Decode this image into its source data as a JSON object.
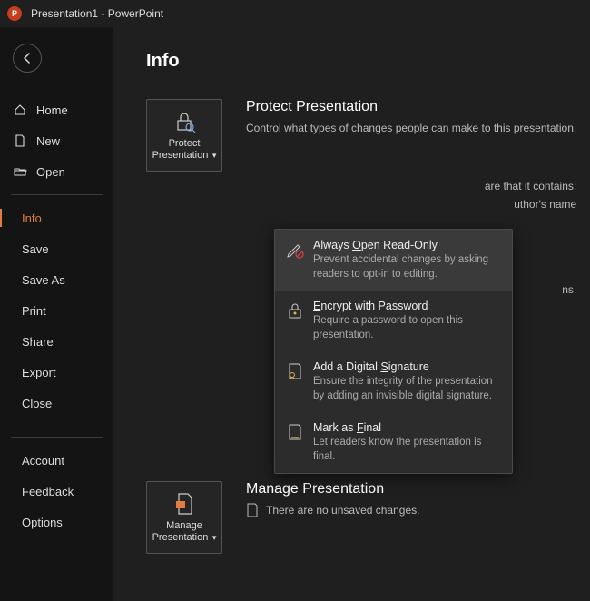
{
  "titlebar": {
    "title": "Presentation1  -  PowerPoint"
  },
  "sidebar": {
    "home": "Home",
    "new": "New",
    "open": "Open",
    "info": "Info",
    "save": "Save",
    "save_as": "Save As",
    "print": "Print",
    "share": "Share",
    "export": "Export",
    "close": "Close",
    "account": "Account",
    "feedback": "Feedback",
    "options": "Options"
  },
  "page": {
    "title": "Info"
  },
  "protect": {
    "button": "Protect Presentation",
    "title": "Protect Presentation",
    "desc": "Control what types of changes people can make to this presentation."
  },
  "inspect": {
    "partial_aware": "are that it contains:",
    "partial_author": "uthor's name"
  },
  "check": {
    "partial_line": "ns."
  },
  "menu": {
    "read_only": {
      "title_pre": "Always ",
      "title_ul": "O",
      "title_post": "pen Read-Only",
      "desc": "Prevent accidental changes by asking readers to opt-in to editing."
    },
    "encrypt": {
      "title_ul": "E",
      "title_post": "ncrypt with Password",
      "desc": "Require a password to open this presentation."
    },
    "signature": {
      "title_pre": "Add a Digital ",
      "title_ul": "S",
      "title_post": "ignature",
      "desc": "Ensure the integrity of the presentation by adding an invisible digital signature."
    },
    "final": {
      "title_pre": "Mark as ",
      "title_ul": "F",
      "title_post": "inal",
      "desc": "Let readers know the presentation is final."
    }
  },
  "manage": {
    "button": "Manage Presentation",
    "title": "Manage Presentation",
    "no_changes": "There are no unsaved changes."
  }
}
